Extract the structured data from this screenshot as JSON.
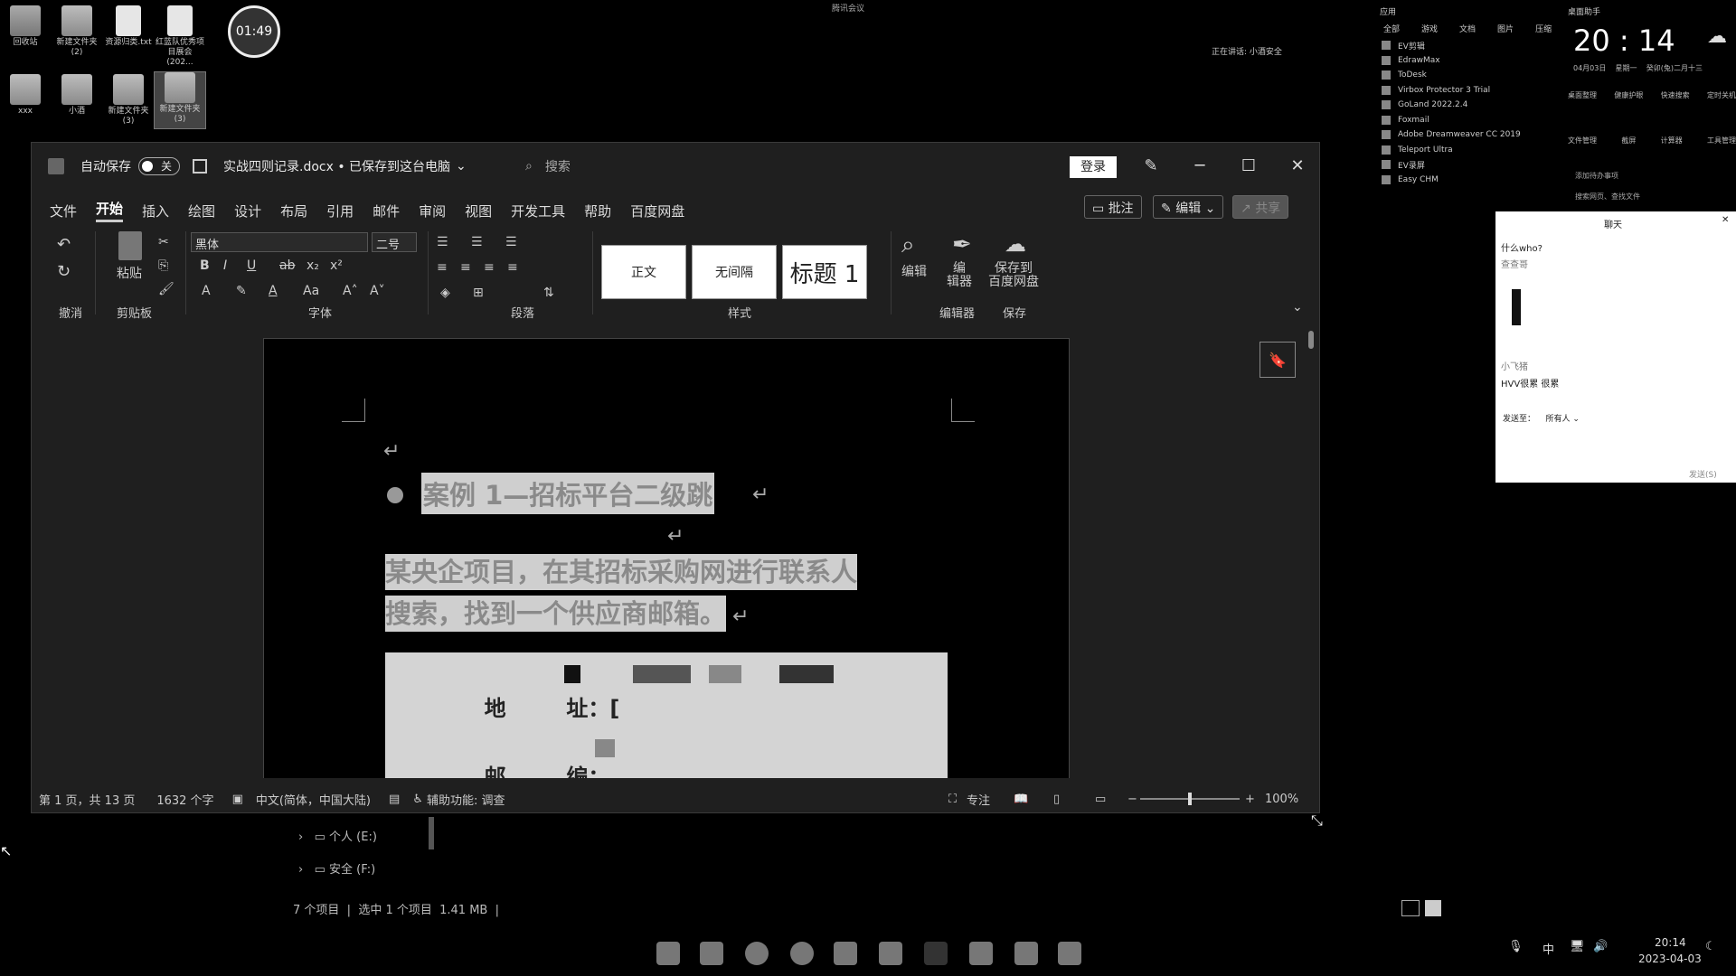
{
  "desktop": {
    "icons": [
      {
        "label": "回收站"
      },
      {
        "label": "新建文件夹 (2)"
      },
      {
        "label": "资源归类.txt"
      },
      {
        "label": "红蓝队优秀项目展会(202..."
      },
      {
        "label": "xxx"
      },
      {
        "label": "小酒"
      },
      {
        "label": "新建文件夹 (3)"
      },
      {
        "label": "新建文件夹 (3)"
      }
    ],
    "timer": "01:49"
  },
  "top_indicator": {
    "meeting": "腾讯会议",
    "speaking": "正在讲话: 小酒安全"
  },
  "word": {
    "autosave_label": "自动保存",
    "autosave_state": "关",
    "doc_title": "实战四则记录.docx • 已保存到这台电脑",
    "search_placeholder": "搜索",
    "login": "登录",
    "menu": [
      "文件",
      "开始",
      "插入",
      "绘图",
      "设计",
      "布局",
      "引用",
      "邮件",
      "审阅",
      "视图",
      "开发工具",
      "帮助",
      "百度网盘"
    ],
    "comment_btn": "批注",
    "edit_btn": "编辑",
    "share_btn": "共享",
    "ribbon": {
      "undo_group": "撤消",
      "paste": "粘贴",
      "clipboard_group": "剪贴板",
      "font_name": "黑体",
      "font_size": "二号",
      "font_group": "字体",
      "para_group": "段落",
      "styles": [
        "正文",
        "无间隔",
        "标题 1"
      ],
      "styles_group": "样式",
      "edit_label": "编辑",
      "editor_label": "编\n辑器",
      "editor_group": "编辑器",
      "save_baidu": "保存到\n百度网盘",
      "save_group": "保存"
    },
    "document": {
      "heading": "案例 1—招标平台二级跳",
      "paragraph_line1": "某央企项目，在其招标采购网进行联系人",
      "paragraph_line2": "搜索，找到一个供应商邮箱。",
      "info_rows": [
        {
          "label": "地        址：",
          "value": "["
        },
        {
          "label": "邮        编：",
          "value": ""
        }
      ]
    },
    "status": {
      "page": "第 1 页，共 13 页",
      "words": "1632 个字",
      "language": "中文(简体，中国大陆)",
      "accessibility": "辅助功能: 调查",
      "focus": "专注",
      "zoom": "100%"
    }
  },
  "explorer": {
    "drive_e": "个人 (E:)",
    "drive_f": "安全 (F:)",
    "status": "7 个项目  |  选中 1 个项目  1.41 MB  |"
  },
  "apps_panel": {
    "header": "应用",
    "tabs": [
      "全部",
      "游戏",
      "文档",
      "图片",
      "压缩"
    ],
    "apps": [
      "EV剪辑",
      "EdrawMax",
      "ToDesk",
      "Virbox Protector 3 Trial",
      "GoLand 2022.2.4",
      "Foxmail",
      "Adobe Dreamweaver CC 2019",
      "Teleport Ultra",
      "EV录屏",
      "Easy CHM"
    ]
  },
  "time_widget": {
    "title": "桌面助手",
    "time": "20 : 14",
    "date": "04月03日",
    "weekday": "星期一",
    "lunar": "癸卯(兔)二月十三",
    "tools": [
      "桌面整理",
      "健康护眼",
      "快速搜索",
      "定时关机",
      "文件管理",
      "截屏",
      "计算器",
      "工具管理"
    ],
    "add_task": "添加待办事项",
    "search_hint": "搜索网页、查找文件"
  },
  "chat": {
    "title": "聊天",
    "msg1_name": "什么who?",
    "msg1_sub": "查查哥",
    "msg2_name": "小飞猪",
    "msg2_text": "HVV很累 很累",
    "send_to_label": "发送至：",
    "send_to_value": "所有人",
    "send_btn": "发送(S)"
  },
  "tray": {
    "ime": "中",
    "time": "20:14",
    "date": "2023-04-03"
  }
}
